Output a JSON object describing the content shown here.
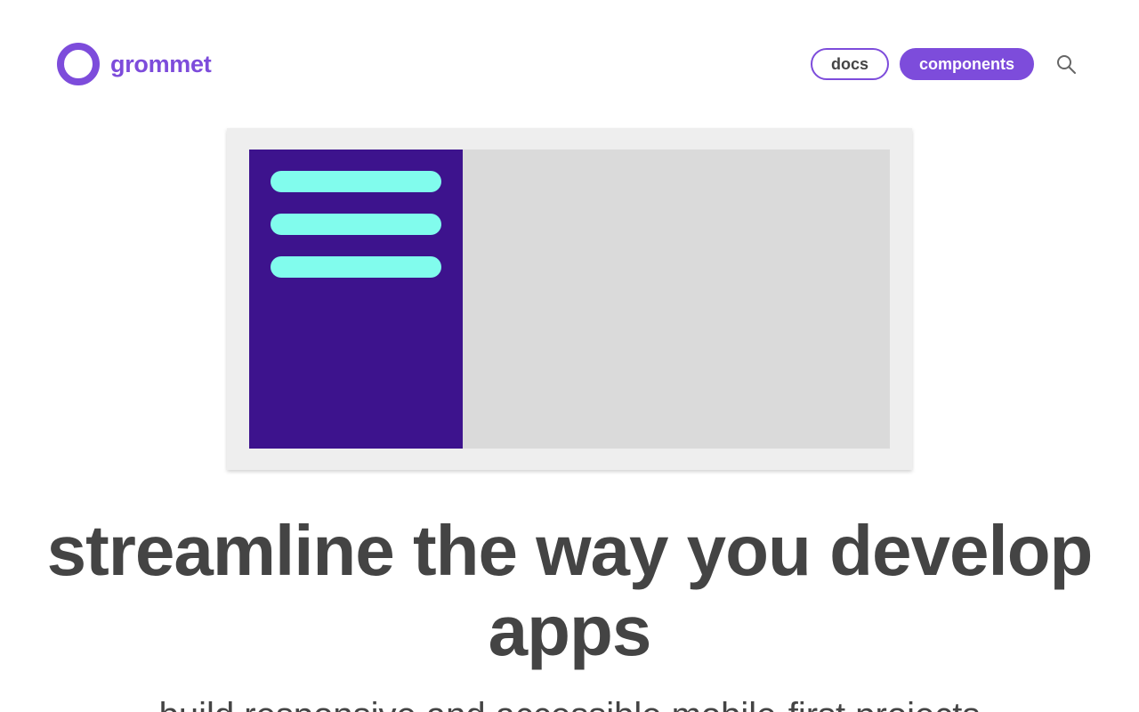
{
  "brand": {
    "name": "grommet",
    "logo_icon": "ring-icon",
    "accent_color": "#7d4cdb"
  },
  "nav": {
    "docs_label": "docs",
    "components_label": "components",
    "search_icon": "search-icon"
  },
  "hero": {
    "illustration": {
      "sidebar_color": "#3d138d",
      "bar_color": "#81fced",
      "main_color": "#dadada",
      "frame_color": "#eeeeee"
    },
    "headline": "streamline the way you develop apps",
    "subheadline": "build responsive and accessible mobile-first projects"
  }
}
